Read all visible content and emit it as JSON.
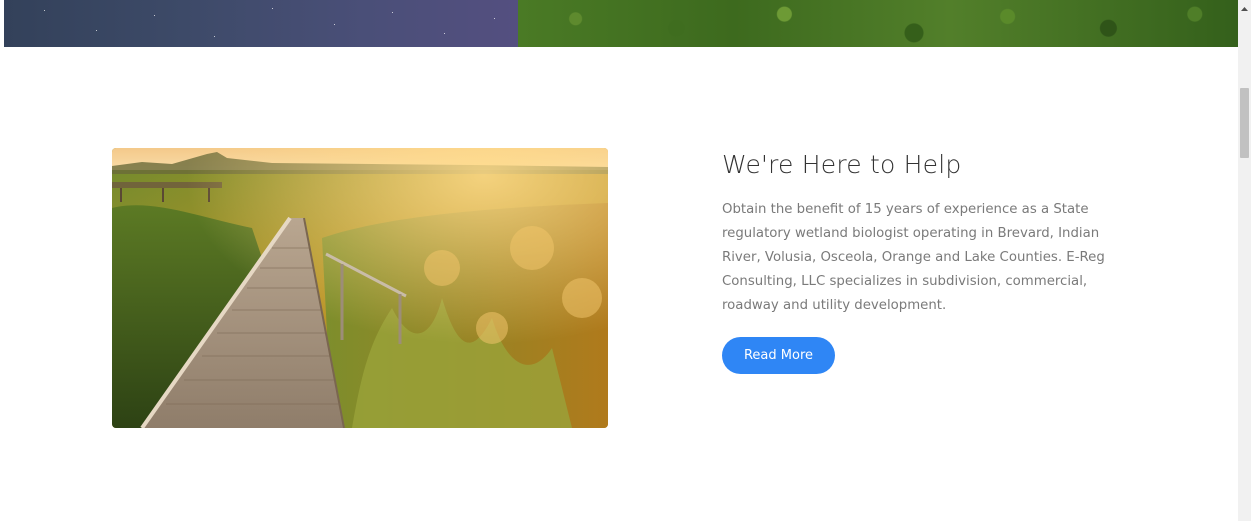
{
  "hero": {
    "left_image": "night-sky-over-water",
    "right_image": "aerial-forest-canopy"
  },
  "feature": {
    "image": "wetland-boardwalk-at-sunset",
    "heading": "We're Here to Help",
    "body": "Obtain the benefit of 15 years of experience as a State regulatory wetland biologist operating in Brevard, Indian River, Volusia, Osceola, Orange and Lake Counties. E-Reg Consulting, LLC specializes in subdivision, commercial, roadway and utility development.",
    "button_label": "Read More"
  },
  "colors": {
    "button": "#2f86f5",
    "heading": "#333333",
    "body_text": "#7a7a7a",
    "background": "#ffffff"
  },
  "scrollbar": {
    "up_icon": "scroll-up-arrow-icon"
  }
}
